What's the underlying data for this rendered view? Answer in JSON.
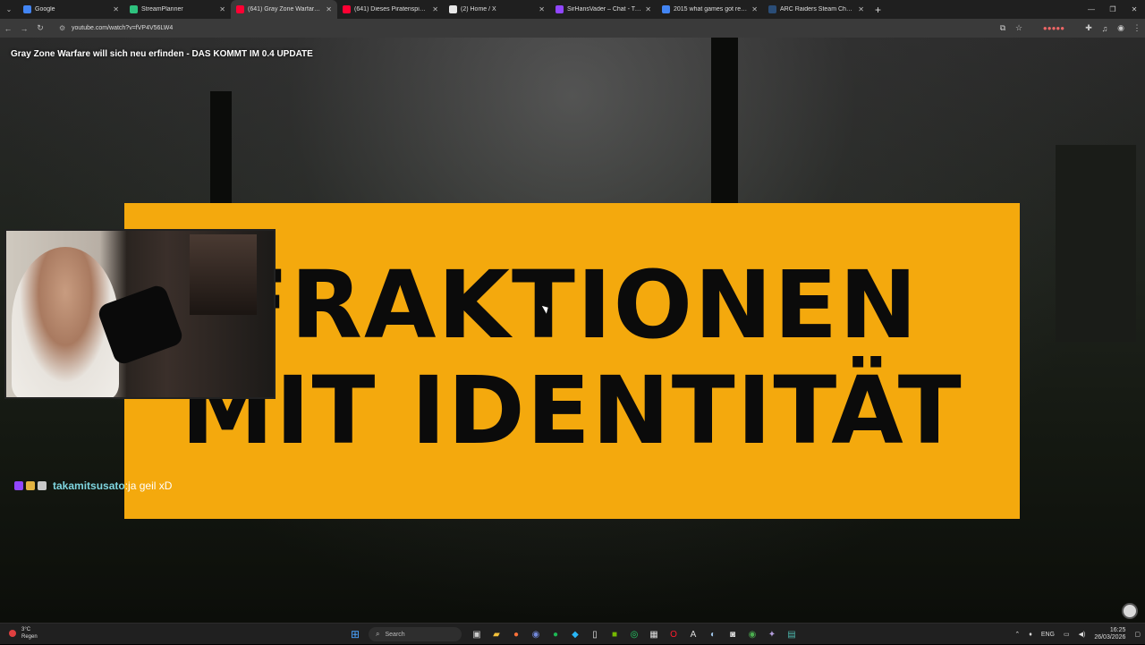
{
  "browser": {
    "tabs": [
      {
        "label": "Google",
        "favicon_color": "#4285f4",
        "active": false
      },
      {
        "label": "StreamPlanner",
        "favicon_color": "#2ec27e",
        "active": false
      },
      {
        "label": "(641) Gray Zone Warfare will si",
        "favicon_color": "#ff0033",
        "active": true
      },
      {
        "label": "(641) Dieses Piratenspiel über",
        "favicon_color": "#ff0033",
        "active": false
      },
      {
        "label": "(2) Home / X",
        "favicon_color": "#e8e8e8",
        "active": false
      },
      {
        "label": "SirHansVader – Chat - Twitch",
        "favicon_color": "#9146ff",
        "active": false
      },
      {
        "label": "2015 what games got released",
        "favicon_color": "#4285f4",
        "active": false
      },
      {
        "label": "ARC Raiders Steam Charts - Ste",
        "favicon_color": "#2a4d77",
        "active": false
      }
    ],
    "new_tab_glyph": "+",
    "url": "youtube.com/watch?v=fVP4V56LW4"
  },
  "video": {
    "title": "Gray Zone Warfare will sich neu erfinden - DAS KOMMT IM 0.4 UPDATE",
    "banner_line1": "FRAKTIONEN",
    "banner_line2": "MIT IDENTITÄT",
    "banner_color": "#f4a90d"
  },
  "chat": {
    "username": "takamitsusato",
    "separator": ":",
    "message": " ja geil xD"
  },
  "taskbar": {
    "weather_temp": "3°C",
    "weather_text": "Regen",
    "search_placeholder": "Search",
    "language": "ENG",
    "time": "16:25",
    "date": "26/03/2026"
  }
}
